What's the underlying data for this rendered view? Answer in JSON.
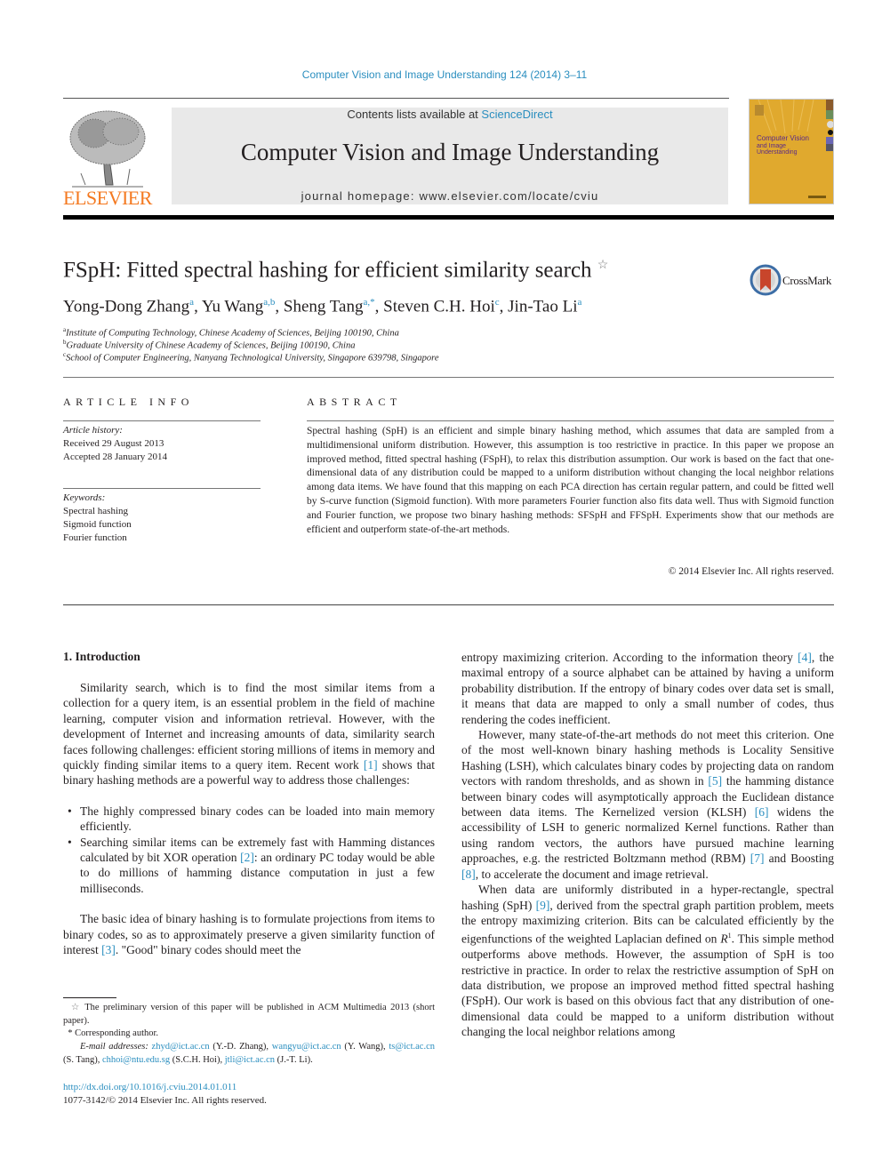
{
  "journal_reference": "Computer Vision and Image Understanding 124 (2014) 3–11",
  "header": {
    "publisher_logo_text": "ELSEVIER",
    "contents_prefix": "Contents lists available at ",
    "contents_link": "ScienceDirect",
    "journal_title": "Computer Vision and Image Understanding",
    "homepage": "journal homepage: www.elsevier.com/locate/cviu",
    "cover": {
      "title": "Computer Vision",
      "subtitle_1": "and Image",
      "subtitle_2": "Understanding"
    }
  },
  "colors": {
    "link": "#2a8ebf",
    "publisher_orange": "#f47920",
    "cover_yellow": "#e0a92e",
    "header_bg": "#e9e9e9"
  },
  "article": {
    "title": "FSpH: Fitted spectral hashing for efficient similarity search",
    "title_note_mark": "☆",
    "crossmark_label": "CrossMark",
    "authors": [
      {
        "name": "Yong-Dong Zhang",
        "aff": "a"
      },
      {
        "name": "Yu Wang",
        "aff": "a,b"
      },
      {
        "name": "Sheng Tang",
        "aff": "a,*"
      },
      {
        "name": "Steven C.H. Hoi",
        "aff": "c"
      },
      {
        "name": "Jin-Tao Li",
        "aff": "a"
      }
    ],
    "affiliations": [
      {
        "mark": "a",
        "text": "Institute of Computing Technology, Chinese Academy of Sciences, Beijing 100190, China"
      },
      {
        "mark": "b",
        "text": "Graduate University of Chinese Academy of Sciences, Beijing 100190, China"
      },
      {
        "mark": "c",
        "text": "School of Computer Engineering, Nanyang Technological University, Singapore 639798, Singapore"
      }
    ]
  },
  "article_info": {
    "heading": "ARTICLE INFO",
    "history_label": "Article history:",
    "received": "Received 29 August 2013",
    "accepted": "Accepted 28 January 2014",
    "keywords_label": "Keywords:",
    "keywords": [
      "Spectral hashing",
      "Sigmoid function",
      "Fourier function"
    ]
  },
  "abstract": {
    "heading": "ABSTRACT",
    "text": "Spectral hashing (SpH) is an efficient and simple binary hashing method, which assumes that data are sampled from a multidimensional uniform distribution. However, this assumption is too restrictive in practice. In this paper we propose an improved method, fitted spectral hashing (FSpH), to relax this distribution assumption. Our work is based on the fact that one-dimensional data of any distribution could be mapped to a uniform distribution without changing the local neighbor relations among data items. We have found that this mapping on each PCA direction has certain regular pattern, and could be fitted well by S-curve function (Sigmoid function). With more parameters Fourier function also fits data well. Thus with Sigmoid function and Fourier function, we propose two binary hashing methods: SFSpH and FFSpH. Experiments show that our methods are efficient and outperform state-of-the-art methods.",
    "copyright": "© 2014 Elsevier Inc. All rights reserved."
  },
  "body": {
    "section_heading": "1. Introduction",
    "left": {
      "p1_a": "Similarity search, which is to find the most similar items from a collection for a query item, is an essential problem in the field of machine learning, computer vision and information retrieval. However, with the development of Internet and increasing amounts of data, similarity search faces following challenges: efficient storing millions of items in memory and quickly finding similar items to a query item. Recent work ",
      "ref1": "[1]",
      "p1_b": " shows that binary hashing methods are a powerful way to address those challenges:",
      "bullet1": "The highly compressed binary codes can be loaded into main memory efficiently.",
      "bullet2_a": "Searching similar items can be extremely fast with Hamming distances calculated by bit XOR operation ",
      "ref2": "[2]",
      "bullet2_b": ": an ordinary PC today would be able to do millions of hamming distance computation in just a few milliseconds.",
      "p2_a": "The basic idea of binary hashing is to formulate projections from items to binary codes, so as to approximately preserve a given similarity function of interest ",
      "ref3": "[3]",
      "p2_b": ". \"Good\" binary codes should meet the"
    },
    "right": {
      "p1_a": "entropy maximizing criterion. According to the information theory ",
      "ref4": "[4]",
      "p1_b": ", the maximal entropy of a source alphabet can be attained by having a uniform probability distribution. If the entropy of binary codes over data set is small, it means that data are mapped to only a small number of codes, thus rendering the codes inefficient.",
      "p2_a": "However, many state-of-the-art methods do not meet this criterion. One of the most well-known binary hashing methods is Locality Sensitive Hashing (LSH), which calculates binary codes by projecting data on random vectors with random thresholds, and as shown in ",
      "ref5": "[5]",
      "p2_b": " the hamming distance between binary codes will asymptotically approach the Euclidean distance between data items. The Kernelized version (KLSH) ",
      "ref6": "[6]",
      "p2_c": " widens the accessibility of LSH to generic normalized Kernel functions. Rather than using random vectors, the authors have pursued machine learning approaches, e.g. the restricted Boltzmann method (RBM) ",
      "ref7": "[7]",
      "p2_d": " and Boosting ",
      "ref8": "[8]",
      "p2_e": ", to accelerate the document and image retrieval.",
      "p3_a": "When data are uniformly distributed in a hyper-rectangle, spectral hashing (SpH) ",
      "ref9": "[9]",
      "p3_b": ", derived from the spectral graph partition problem, meets the entropy maximizing criterion. Bits can be calculated efficiently by the eigenfunctions of the weighted Laplacian defined on ",
      "p3_math": "R",
      "p3_sup": "1",
      "p3_c": ". This simple method outperforms above methods. However, the assumption of SpH is too restrictive in practice. In order to relax the restrictive assumption of SpH on data distribution, we propose an improved method fitted spectral hashing (FSpH). Our work is based on this obvious fact that any distribution of one-dimensional data could be mapped to a uniform distribution without changing the local neighbor relations among"
    }
  },
  "footnotes": {
    "star_mark": "☆",
    "star_text": "The preliminary version of this paper will be published in ACM Multimedia 2013 (short paper).",
    "corr_mark": "*",
    "corr_text": "Corresponding author.",
    "email_label": "E-mail addresses:",
    "emails": [
      {
        "addr": "zhyd@ict.ac.cn",
        "who": " (Y.-D. Zhang), "
      },
      {
        "addr": "wangyu@ict.ac.cn",
        "who": " (Y. Wang), "
      },
      {
        "addr": "ts@ict.ac.cn",
        "who": " (S. Tang), "
      },
      {
        "addr": "chhoi@ntu.edu.sg",
        "who": " (S.C.H. Hoi), "
      },
      {
        "addr": "jtli@ict.ac.cn",
        "who": " (J.-T. Li)."
      }
    ],
    "doi": "http://dx.doi.org/10.1016/j.cviu.2014.01.011",
    "issn": "1077-3142/© 2014 Elsevier Inc. All rights reserved."
  }
}
